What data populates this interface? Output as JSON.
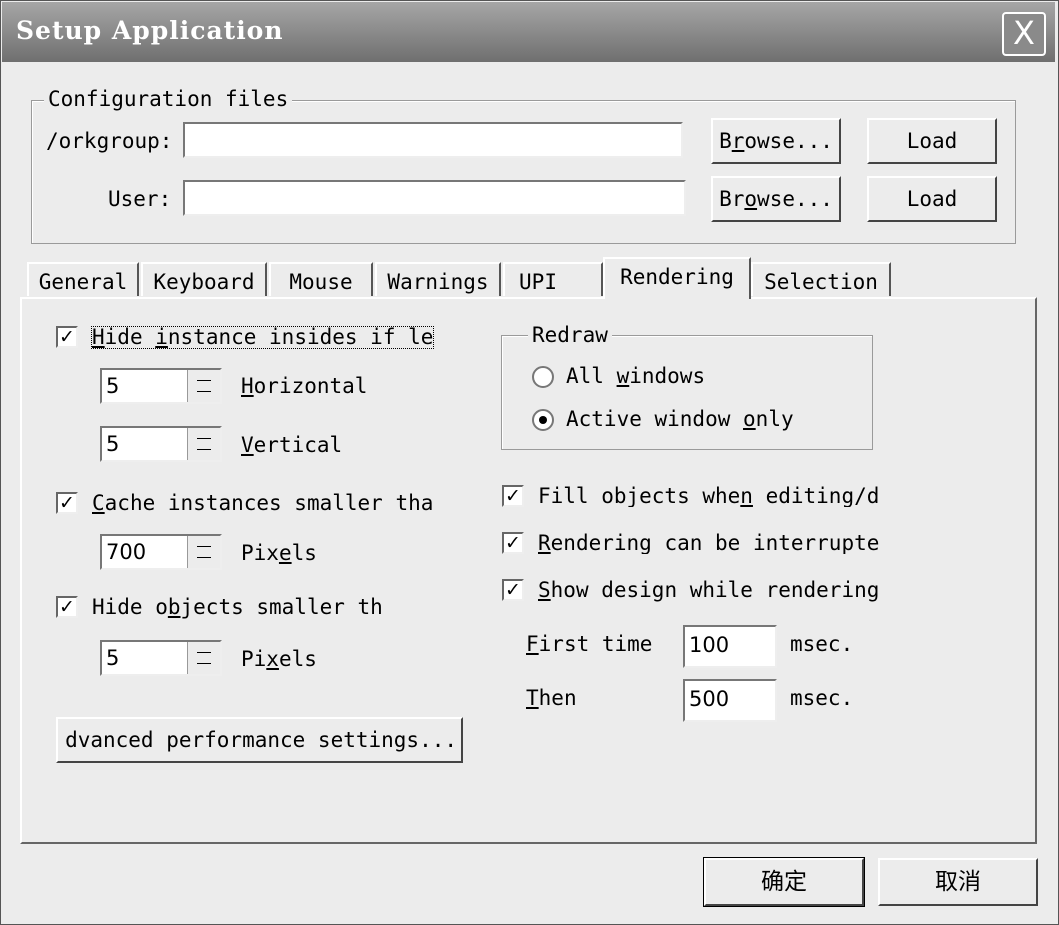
{
  "window": {
    "title": "Setup Application",
    "close_glyph": "X"
  },
  "config": {
    "legend": "Configuration files",
    "workgroup_label": "/orkgroup:",
    "workgroup_value": "",
    "user_label": "User:",
    "user_value": "",
    "browse_1": {
      "pre": "B",
      "u": "r",
      "post": "owse..."
    },
    "browse_2": {
      "pre": "Br",
      "u": "o",
      "post": "wse..."
    },
    "load_1": "Load",
    "load_2": "Load"
  },
  "tabs": [
    {
      "label": "General"
    },
    {
      "label": "Keyboard"
    },
    {
      "label": "Mouse"
    },
    {
      "label": "Warnings"
    },
    {
      "label": "UPI"
    },
    {
      "label": "Rendering",
      "selected": true
    },
    {
      "label": "Selection"
    }
  ],
  "left": {
    "hide_instance": {
      "checked": "✓",
      "pre": "",
      "u": "H",
      "mid": "ide ",
      "u2": "i",
      "post": "nstance insides if le"
    },
    "horizontal": {
      "value": "5",
      "u": "H",
      "post": "orizontal"
    },
    "vertical": {
      "value": "5",
      "u": "V",
      "post": "ertical"
    },
    "cache_instances": {
      "checked": "✓",
      "u": "C",
      "post": "ache instances smaller tha"
    },
    "cache_pixels": {
      "value": "700",
      "pre": "Pix",
      "u": "e",
      "post": "ls"
    },
    "hide_objects": {
      "checked": "✓",
      "pre": "Hide o",
      "u": "b",
      "post": "jects smaller th"
    },
    "objects_pixels": {
      "value": "5",
      "pre": "Pi",
      "u": "x",
      "post": "els"
    },
    "advanced_button": "dvanced performance settings..."
  },
  "right": {
    "redraw_legend": "Redraw",
    "all_windows": {
      "pre": "All ",
      "u": "w",
      "post": "indows",
      "selected": false
    },
    "active_window": {
      "pre": "Active window ",
      "u": "o",
      "post": "nly",
      "selected": true
    },
    "fill_objects": {
      "checked": "✓",
      "pre": "Fill objects whe",
      "u": "n",
      "post": " editing/d"
    },
    "rendering_interrupted": {
      "checked": "✓",
      "u": "R",
      "post": "endering can be interrupte"
    },
    "show_design": {
      "checked": "✓",
      "u": "S",
      "post": "how design while rendering"
    },
    "first_time": {
      "u": "F",
      "post": "irst time",
      "value": "100",
      "unit": "msec."
    },
    "then": {
      "u": "T",
      "post": "hen",
      "value": "500",
      "unit": "msec."
    }
  },
  "footer": {
    "ok": "确定",
    "cancel": "取消"
  }
}
